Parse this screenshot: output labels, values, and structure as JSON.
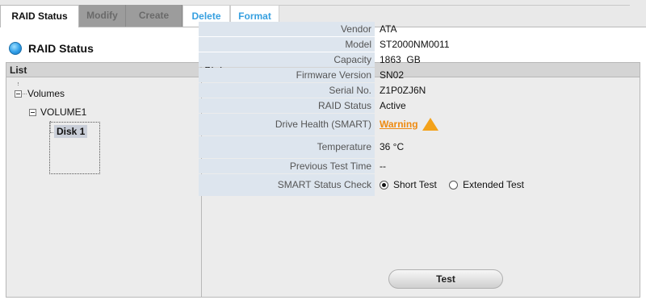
{
  "tabs": [
    {
      "label": "RAID Status",
      "state": "active"
    },
    {
      "label": "Modify",
      "state": "disabled"
    },
    {
      "label": "Create",
      "state": "disabled"
    },
    {
      "label": "Delete",
      "state": "enabled"
    },
    {
      "label": "Format",
      "state": "enabled"
    }
  ],
  "section_title": "RAID Status",
  "headers": {
    "list": "List",
    "status": "Status"
  },
  "tree": {
    "root": "Volumes",
    "volume": "VOLUME1",
    "disk": "Disk 1"
  },
  "status": {
    "rows": [
      {
        "label": "Vendor",
        "value": "ATA"
      },
      {
        "label": "Model",
        "value": "ST2000NM0011"
      },
      {
        "label": "Capacity",
        "value": "1863  GB"
      },
      {
        "label": "Firmware Version",
        "value": "SN02"
      },
      {
        "label": "Serial No.",
        "value": "Z1P0ZJ6N"
      },
      {
        "label": "RAID Status",
        "value": "Active"
      }
    ],
    "health_label": "Drive Health (SMART)",
    "health_value": "Warning",
    "health_icon": "warning-triangle-icon",
    "temperature_label": "Temperature",
    "temperature_value": "36 °C",
    "prev_test_label": "Previous Test Time",
    "prev_test_value": "--",
    "smart_check_label": "SMART Status Check",
    "smart_options": [
      "Short Test",
      "Extended Test"
    ],
    "smart_selected": "Short Test"
  },
  "test_button": "Test",
  "colors": {
    "accent_link": "#37a0e0",
    "warning": "#ee8a10",
    "label_bg": "#dde5ee"
  }
}
